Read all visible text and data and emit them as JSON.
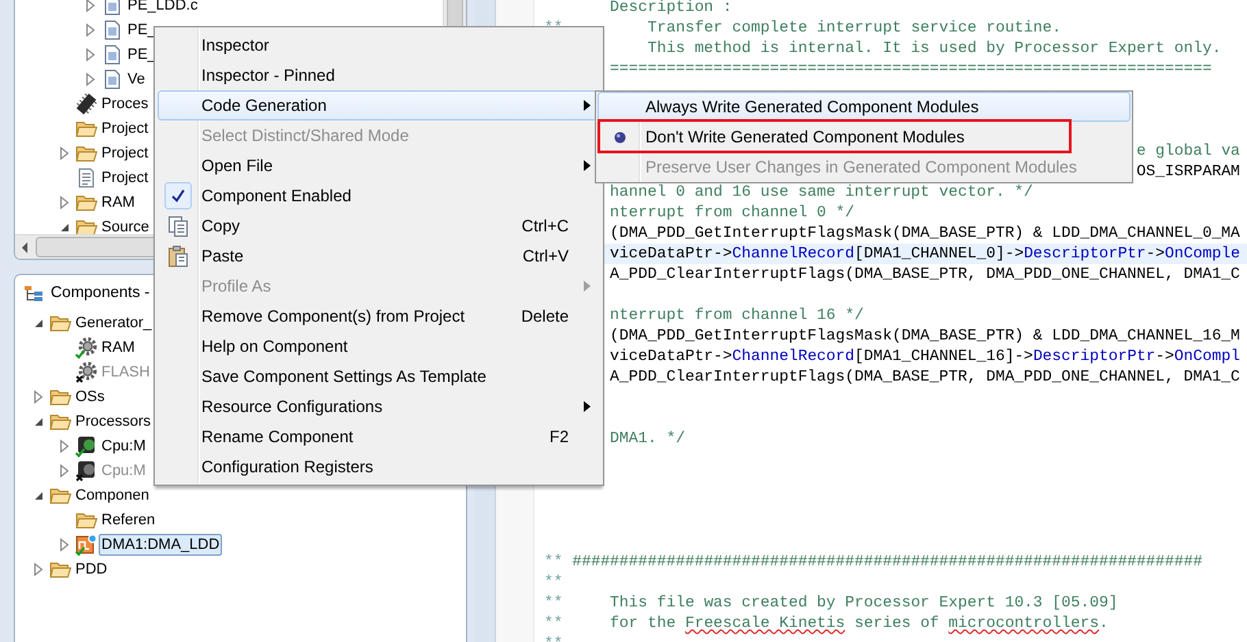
{
  "project_explorer": {
    "tree": {
      "items": [
        {
          "children": [
            {
              "label": "PE_LDD.c",
              "kind": "file",
              "expanded": false,
              "disabled": false,
              "selected": false
            },
            {
              "label": "PE_",
              "kind": "file",
              "expanded": false,
              "disabled": false,
              "selected": false
            },
            {
              "label": "PE_",
              "kind": "file",
              "expanded": false,
              "disabled": false,
              "selected": false
            },
            {
              "label": "Ve",
              "kind": "file",
              "expanded": false,
              "disabled": false,
              "selected": false
            }
          ]
        },
        {
          "label": "Proces",
          "kind": "chip",
          "disabled": false,
          "selected": false
        },
        {
          "label": "Project",
          "kind": "folder",
          "disabled": false,
          "selected": false
        },
        {
          "label": "Project",
          "kind": "folder",
          "expanded": false,
          "disabled": false,
          "selected": false
        },
        {
          "label": "Project",
          "kind": "document",
          "disabled": false,
          "selected": false
        },
        {
          "label": "RAM",
          "kind": "folder",
          "expanded": false,
          "disabled": false,
          "selected": false
        },
        {
          "label": "Source",
          "kind": "folder",
          "expanded": true,
          "disabled": false,
          "selected": false
        }
      ]
    }
  },
  "components_view": {
    "title": "Components -",
    "tree": {
      "items": [
        {
          "label": "Generator_",
          "kind": "folder",
          "expanded": true,
          "disabled": false,
          "selected": false,
          "children": [
            {
              "label": "RAM",
              "kind": "gear",
              "disabled": false,
              "selected": false
            },
            {
              "label": "FLASH",
              "kind": "gear",
              "disabled": true,
              "selected": false
            }
          ]
        },
        {
          "label": "OSs",
          "kind": "folder",
          "expanded": false,
          "disabled": false,
          "selected": false
        },
        {
          "label": "Processors",
          "kind": "folder",
          "expanded": true,
          "disabled": false,
          "selected": false,
          "children": [
            {
              "label": "Cpu:M",
              "kind": "cpu",
              "expanded": false,
              "disabled": false,
              "selected": false
            },
            {
              "label": "Cpu:M",
              "kind": "cpu",
              "expanded": false,
              "disabled": true,
              "selected": false
            }
          ]
        },
        {
          "label": "Componen",
          "kind": "folder",
          "expanded": true,
          "disabled": false,
          "selected": false,
          "children": [
            {
              "label": "Referen",
              "kind": "folder",
              "disabled": false,
              "selected": false
            },
            {
              "label": "DMA1:DMA_LDD",
              "kind": "component",
              "expanded": false,
              "disabled": false,
              "selected": true
            }
          ]
        },
        {
          "label": "PDD",
          "kind": "folder",
          "expanded": false,
          "disabled": false,
          "selected": false
        }
      ]
    }
  },
  "editor": {
    "lines": [
      {
        "kind": "code",
        "current": false,
        "segments": [
          {
            "text": "       Description :",
            "kind": "comment"
          }
        ]
      },
      {
        "kind": "code",
        "current": false,
        "segments": [
          {
            "text": "**",
            "kind": "gutter"
          },
          {
            "text": "         Transfer complete interrupt service routine.",
            "kind": "comment"
          }
        ]
      },
      {
        "kind": "code",
        "current": false,
        "segments": [
          {
            "text": "           This method is internal. It is used by Processor Expert only.",
            "kind": "comment"
          }
        ]
      },
      {
        "kind": "code",
        "current": false,
        "segments": [
          {
            "text": "       ================================================================",
            "kind": "comment"
          }
        ]
      },
      {
        "kind": "blank"
      },
      {
        "kind": "blank"
      },
      {
        "kind": "blank"
      },
      {
        "kind": "code",
        "current": false,
        "segments": [
          {
            "text": "                                                               e global va",
            "kind": "comment"
          }
        ]
      },
      {
        "kind": "code",
        "current": false,
        "segments": [
          {
            "text": "                                                               OS_ISRPARAM",
            "kind": "code"
          }
        ]
      },
      {
        "kind": "code",
        "current": false,
        "segments": [
          {
            "text": "       hannel 0 and 16 use same interrupt vector. */",
            "kind": "comment"
          }
        ]
      },
      {
        "kind": "code",
        "current": false,
        "segments": [
          {
            "text": "       nterrupt from channel 0 */",
            "kind": "comment"
          }
        ]
      },
      {
        "kind": "code",
        "current": false,
        "segments": [
          {
            "text": "       (DMA_PDD_GetInterruptFlagsMask(DMA_BASE_PTR) & LDD_DMA_CHANNEL_0_MA",
            "kind": "code"
          }
        ]
      },
      {
        "kind": "code",
        "current": true,
        "segments": [
          {
            "text": "       viceDataPtr->",
            "kind": "code"
          },
          {
            "text": "ChannelRecord",
            "kind": "field"
          },
          {
            "text": "[DMA1_CHANNEL_0]->",
            "kind": "code"
          },
          {
            "text": "DescriptorPtr",
            "kind": "field"
          },
          {
            "text": "->",
            "kind": "code"
          },
          {
            "text": "OnComple",
            "kind": "field"
          }
        ]
      },
      {
        "kind": "code",
        "current": false,
        "segments": [
          {
            "text": "       A_PDD_ClearInterruptFlags(DMA_BASE_PTR, DMA_PDD_ONE_CHANNEL, DMA1_C",
            "kind": "code"
          }
        ]
      },
      {
        "kind": "blank"
      },
      {
        "kind": "code",
        "current": false,
        "segments": [
          {
            "text": "       nterrupt from channel 16 */",
            "kind": "comment"
          }
        ]
      },
      {
        "kind": "code",
        "current": false,
        "segments": [
          {
            "text": "       (DMA_PDD_GetInterruptFlagsMask(DMA_BASE_PTR) & LDD_DMA_CHANNEL_16_M",
            "kind": "code"
          }
        ]
      },
      {
        "kind": "code",
        "current": false,
        "segments": [
          {
            "text": "       viceDataPtr->",
            "kind": "code"
          },
          {
            "text": "ChannelRecord",
            "kind": "field"
          },
          {
            "text": "[DMA1_CHANNEL_16]->",
            "kind": "code"
          },
          {
            "text": "DescriptorPtr",
            "kind": "field"
          },
          {
            "text": "->",
            "kind": "code"
          },
          {
            "text": "OnCompl",
            "kind": "field"
          }
        ]
      },
      {
        "kind": "code",
        "current": false,
        "segments": [
          {
            "text": "       A_PDD_ClearInterruptFlags(DMA_BASE_PTR, DMA_PDD_ONE_CHANNEL, DMA1_C",
            "kind": "code"
          }
        ]
      },
      {
        "kind": "blank"
      },
      {
        "kind": "blank"
      },
      {
        "kind": "code",
        "current": false,
        "segments": [
          {
            "text": "       DMA1. */",
            "kind": "comment"
          }
        ]
      },
      {
        "kind": "blank"
      },
      {
        "kind": "blank"
      },
      {
        "kind": "blank"
      },
      {
        "kind": "blank"
      },
      {
        "kind": "blank"
      },
      {
        "kind": "code",
        "current": false,
        "segments": [
          {
            "text": "**",
            "kind": "gutter"
          },
          {
            "text": " ###################################################################",
            "kind": "comment"
          }
        ]
      },
      {
        "kind": "code",
        "current": false,
        "segments": [
          {
            "text": "**",
            "kind": "gutter"
          }
        ]
      },
      {
        "kind": "code",
        "current": false,
        "segments": [
          {
            "text": "**",
            "kind": "gutter"
          },
          {
            "text": "     This file was created by Processor Expert 10.3 [05.09]",
            "kind": "comment"
          }
        ]
      },
      {
        "kind": "code",
        "current": false,
        "segments": [
          {
            "text": "**",
            "kind": "gutter"
          },
          {
            "text": "     for the ",
            "kind": "comment"
          },
          {
            "text": "Freescale Kinetis",
            "kind": "misspelled"
          },
          {
            "text": " series of ",
            "kind": "comment"
          },
          {
            "text": "microcontrollers",
            "kind": "misspelled"
          },
          {
            "text": ".",
            "kind": "comment"
          }
        ]
      },
      {
        "kind": "code",
        "current": false,
        "segments": [
          {
            "text": "**",
            "kind": "gutter"
          }
        ]
      }
    ]
  },
  "context_menu": {
    "items": [
      {
        "kind": "item",
        "label": "Inspector",
        "highlighted": false,
        "disabled": false,
        "checked": false,
        "submenu": false
      },
      {
        "kind": "item",
        "label": "Inspector - Pinned",
        "highlighted": false,
        "disabled": false,
        "checked": false,
        "submenu": false
      },
      {
        "kind": "item",
        "label": "Code Generation",
        "highlighted": true,
        "disabled": false,
        "checked": false,
        "submenu": true
      },
      {
        "kind": "separator"
      },
      {
        "kind": "item",
        "label": "Select Distinct/Shared Mode",
        "highlighted": false,
        "disabled": true,
        "checked": false,
        "submenu": false
      },
      {
        "kind": "item",
        "label": "Open File",
        "highlighted": false,
        "disabled": false,
        "checked": false,
        "submenu": true
      },
      {
        "kind": "item",
        "label": "Component Enabled",
        "highlighted": false,
        "disabled": false,
        "checked": true,
        "submenu": false
      },
      {
        "kind": "copy",
        "label": "Copy",
        "shortcut": "Ctrl+C",
        "highlighted": false,
        "disabled": false,
        "checked": false,
        "submenu": false
      },
      {
        "kind": "paste",
        "label": "Paste",
        "shortcut": "Ctrl+V",
        "highlighted": false,
        "disabled": false,
        "checked": false,
        "submenu": false
      },
      {
        "kind": "separator"
      },
      {
        "kind": "item",
        "label": "Profile As",
        "highlighted": false,
        "disabled": true,
        "checked": false,
        "submenu": true
      },
      {
        "kind": "item",
        "label": "Remove Component(s) from Project",
        "shortcut": "Delete",
        "highlighted": false,
        "disabled": false,
        "checked": false,
        "submenu": false
      },
      {
        "kind": "item",
        "label": "Help on Component",
        "highlighted": false,
        "disabled": false,
        "checked": false,
        "submenu": false
      },
      {
        "kind": "item",
        "label": "Save Component Settings As Template",
        "highlighted": false,
        "disabled": false,
        "checked": false,
        "submenu": false
      },
      {
        "kind": "separator"
      },
      {
        "kind": "item",
        "label": "Resource Configurations",
        "highlighted": false,
        "disabled": false,
        "checked": false,
        "submenu": true
      },
      {
        "kind": "separator"
      },
      {
        "kind": "item",
        "label": "Rename Component",
        "shortcut": "F2",
        "highlighted": false,
        "disabled": false,
        "checked": false,
        "submenu": false
      },
      {
        "kind": "separator"
      },
      {
        "kind": "item",
        "label": "Configuration Registers",
        "highlighted": false,
        "disabled": false,
        "checked": false,
        "submenu": false
      }
    ]
  },
  "submenu": {
    "items": [
      {
        "label": "Always Write Generated Component Modules",
        "highlighted": true,
        "disabled": false,
        "selected": false,
        "outlined": false
      },
      {
        "label": "Don't Write Generated Component Modules",
        "highlighted": false,
        "disabled": false,
        "selected": true,
        "outlined": true
      },
      {
        "label": "Preserve User Changes in Generated Component Modules",
        "highlighted": false,
        "disabled": true,
        "selected": false,
        "outlined": false
      }
    ]
  }
}
